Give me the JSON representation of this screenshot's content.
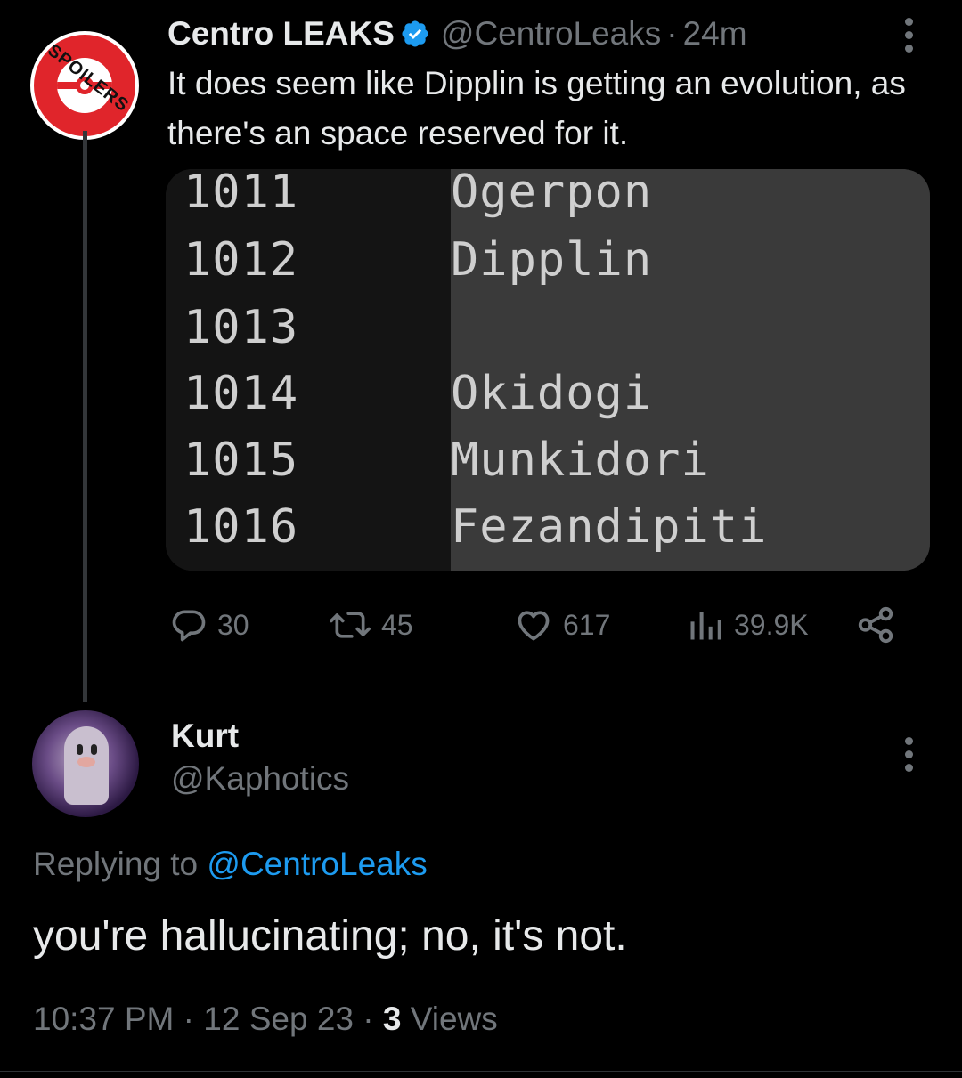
{
  "parent_tweet": {
    "avatar_stamp": "SPOILERS",
    "display_name": "Centro LEAKS",
    "handle": "@CentroLeaks",
    "separator": "·",
    "time": "24m",
    "text": "It does seem like Dipplin is getting an evolution, as there's an space reserved for it.",
    "media": {
      "rows": [
        {
          "num": "1011",
          "name": "Ogerpon"
        },
        {
          "num": "1012",
          "name": "Dipplin"
        },
        {
          "num": "1013",
          "name": ""
        },
        {
          "num": "1014",
          "name": "Okidogi"
        },
        {
          "num": "1015",
          "name": "Munkidori"
        },
        {
          "num": "1016",
          "name": "Fezandipiti"
        }
      ]
    },
    "actions": {
      "replies": "30",
      "reposts": "45",
      "likes": "617",
      "views": "39.9K"
    }
  },
  "reply_tweet": {
    "display_name": "Kurt",
    "handle": "@Kaphotics",
    "replying_prefix": "Replying to ",
    "replying_to": "@CentroLeaks",
    "text": "you're hallucinating; no, it's not.",
    "time": "10:37 PM",
    "sep1": " · ",
    "date": "12 Sep 23",
    "sep2": " · ",
    "views_count": "3",
    "views_label": " Views"
  },
  "colors": {
    "background": "#000000",
    "primary_text": "#e7e9ea",
    "secondary_text": "#71767b",
    "link": "#1d9bf0",
    "verified": "#1d9bf0"
  }
}
